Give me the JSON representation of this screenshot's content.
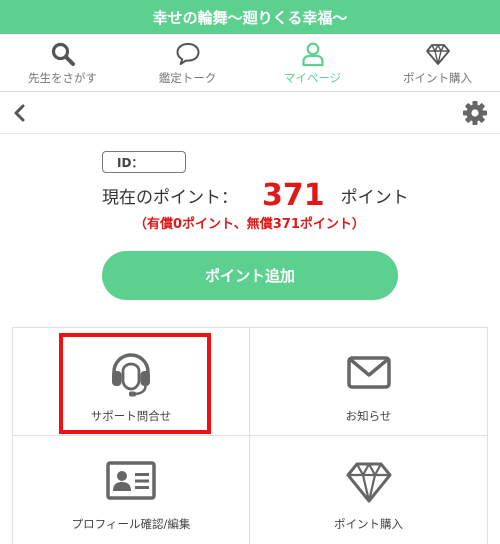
{
  "app_title": "幸せの輪舞〜廻りくる幸福〜",
  "nav": {
    "items": [
      {
        "label": "先生をさがす",
        "icon": "search-icon"
      },
      {
        "label": "鑑定トーク",
        "icon": "speech-bubble-icon"
      },
      {
        "label": "マイページ",
        "icon": "user-icon",
        "active": true
      },
      {
        "label": "ポイント購入",
        "icon": "diamond-icon"
      }
    ]
  },
  "toolbar": {
    "back_icon": "chevron-left-icon",
    "settings_icon": "gear-icon"
  },
  "account": {
    "id_label": "ID：",
    "points_label": "現在のポイント：",
    "points_value": "371",
    "points_unit": "ポイント",
    "points_breakdown": "（有償0ポイント、無償371ポイント）"
  },
  "add_points_button": "ポイント追加",
  "menu": {
    "items": [
      {
        "label": "サポート問合せ",
        "icon": "headset-icon"
      },
      {
        "label": "お知らせ",
        "icon": "envelope-icon"
      },
      {
        "label": "プロフィール確認/編集",
        "icon": "id-card-icon"
      },
      {
        "label": "ポイント購入",
        "icon": "diamond-icon"
      }
    ]
  },
  "colors": {
    "accent": "#5cd08f",
    "points": "#e01818",
    "highlight": "#ee1111",
    "icon_gray": "#666666"
  }
}
